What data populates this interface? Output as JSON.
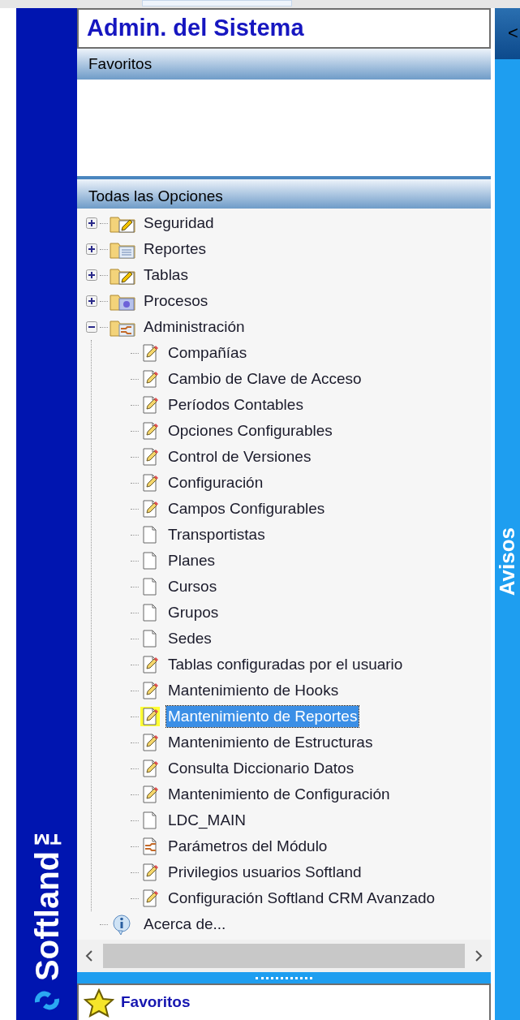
{
  "title": "Admin. del Sistema",
  "favorites_header": "Favoritos",
  "all_options_header": "Todas las Opciones",
  "tree": [
    {
      "label": "Seguridad",
      "kind": "folder-edit",
      "expanded": false,
      "selected": false
    },
    {
      "label": "Reportes",
      "kind": "folder-report",
      "expanded": false,
      "selected": false
    },
    {
      "label": "Tablas",
      "kind": "folder-edit",
      "expanded": false,
      "selected": false
    },
    {
      "label": "Procesos",
      "kind": "folder-gear",
      "expanded": false,
      "selected": false
    },
    {
      "label": "Administración",
      "kind": "folder-tool",
      "expanded": true,
      "selected": false,
      "children": [
        {
          "label": "Compañías",
          "kind": "edit",
          "selected": false
        },
        {
          "label": "Cambio de Clave de Acceso",
          "kind": "edit",
          "selected": false
        },
        {
          "label": "Períodos Contables",
          "kind": "edit",
          "selected": false
        },
        {
          "label": "Opciones Configurables",
          "kind": "edit",
          "selected": false
        },
        {
          "label": "Control de Versiones",
          "kind": "edit",
          "selected": false
        },
        {
          "label": "Configuración",
          "kind": "edit",
          "selected": false
        },
        {
          "label": "Campos Configurables",
          "kind": "edit",
          "selected": false
        },
        {
          "label": "Transportistas",
          "kind": "doc",
          "selected": false
        },
        {
          "label": "Planes",
          "kind": "doc",
          "selected": false
        },
        {
          "label": "Cursos",
          "kind": "doc",
          "selected": false
        },
        {
          "label": "Grupos",
          "kind": "doc",
          "selected": false
        },
        {
          "label": "Sedes",
          "kind": "doc",
          "selected": false
        },
        {
          "label": "Tablas configuradas por el usuario",
          "kind": "edit",
          "selected": false
        },
        {
          "label": "Mantenimiento de Hooks",
          "kind": "edit",
          "selected": false
        },
        {
          "label": "Mantenimiento de Reportes",
          "kind": "edit",
          "selected": true
        },
        {
          "label": "Mantenimiento de Estructuras",
          "kind": "edit",
          "selected": false
        },
        {
          "label": "Consulta Diccionario Datos",
          "kind": "edit",
          "selected": false
        },
        {
          "label": "Mantenimiento de Configuración",
          "kind": "edit",
          "selected": false
        },
        {
          "label": "LDC_MAIN",
          "kind": "doc",
          "selected": false
        },
        {
          "label": "Parámetros del Módulo",
          "kind": "tool",
          "selected": false
        },
        {
          "label": "Privilegios usuarios Softland",
          "kind": "edit",
          "selected": false
        },
        {
          "label": "Configuración Softland CRM Avanzado",
          "kind": "edit",
          "selected": false
        }
      ]
    },
    {
      "label": "Acerca de...",
      "kind": "info",
      "selected": false
    }
  ],
  "bottom_bar": {
    "label": "Favoritos"
  },
  "brand": "Softland™",
  "side_panel": {
    "button": "<",
    "label": "Avisos"
  }
}
